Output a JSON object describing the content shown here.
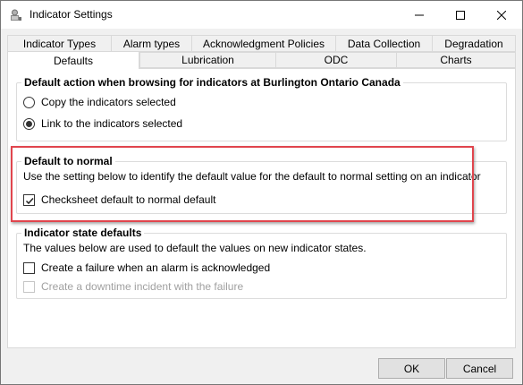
{
  "window": {
    "title": "Indicator Settings"
  },
  "tabs": {
    "row1": [
      {
        "label": "Indicator Types"
      },
      {
        "label": "Alarm types"
      },
      {
        "label": "Acknowledgment Policies"
      },
      {
        "label": "Data Collection"
      },
      {
        "label": "Degradation"
      }
    ],
    "row2": [
      {
        "label": "Defaults",
        "active": true
      },
      {
        "label": "Lubrication"
      },
      {
        "label": "ODC"
      },
      {
        "label": "Charts"
      }
    ]
  },
  "default_action": {
    "legend": "Default action when browsing for indicators at Burlington Ontario Canada",
    "options": [
      {
        "label": "Copy the indicators selected",
        "selected": false
      },
      {
        "label": "Link to the indicators selected",
        "selected": true
      }
    ]
  },
  "default_to_normal": {
    "legend": "Default to normal",
    "description": "Use the setting below to identify the default value for the default to normal setting on an indicator",
    "checkbox_label": "Checksheet default to normal default",
    "checked": true
  },
  "state_defaults": {
    "legend": "Indicator state defaults",
    "description": "The values below are used to default the values on new indicator states.",
    "options": [
      {
        "label": "Create a failure when an alarm is acknowledged",
        "checked": false,
        "enabled": true
      },
      {
        "label": "Create a downtime incident with the failure",
        "checked": false,
        "enabled": false
      }
    ]
  },
  "footer": {
    "ok_label": "OK",
    "cancel_label": "Cancel"
  },
  "colors": {
    "highlight": "#e0454d",
    "panel_bg": "#ffffff",
    "window_bg": "#f0f0f0"
  }
}
